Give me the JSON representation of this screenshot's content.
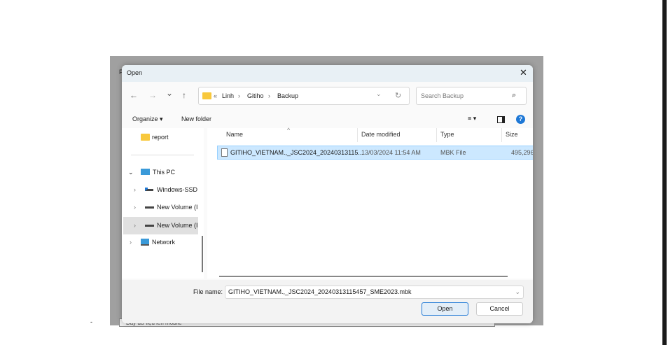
{
  "background": {
    "left_char": "P",
    "dash": "-",
    "bottom_text": "Đẩy dữ liệu lên mobile"
  },
  "dialog": {
    "title": "Open",
    "close": "✕"
  },
  "nav": {
    "back": "←",
    "forward": "→",
    "recent": "⌄",
    "up": "↑"
  },
  "address": {
    "overflow": "«",
    "crumbs": [
      "Linh",
      "Gitiho",
      "Backup"
    ],
    "sep": "›",
    "dropdown": "⌄",
    "refresh": "↻"
  },
  "search": {
    "placeholder": "Search Backup",
    "icon": "⌕"
  },
  "toolbar": {
    "organize": "Organize ▾",
    "new_folder": "New folder",
    "view": "≡ ▾",
    "help": "?"
  },
  "sidebar": {
    "items": [
      {
        "label": "report",
        "icon": "folder-icon"
      },
      {
        "label": "This PC",
        "chevron": "⌄",
        "icon": "computer-icon"
      },
      {
        "label": "Windows-SSD",
        "chevron": "›",
        "icon": "drive-icon"
      },
      {
        "label": "New Volume (I",
        "chevron": "›",
        "icon": "drive-icon"
      },
      {
        "label": "New Volume (I",
        "chevron": "›",
        "icon": "drive-icon",
        "selected": true
      },
      {
        "label": "Network",
        "chevron": "›",
        "icon": "network-icon"
      }
    ]
  },
  "columns": {
    "name": "Name",
    "date": "Date modified",
    "type": "Type",
    "size": "Size",
    "sort": "^"
  },
  "files": [
    {
      "name": "GITIHO_VIETNAM.,_JSC2024_20240313115...",
      "date": "13/03/2024 11:54 AM",
      "type": "MBK File",
      "size": "495,296"
    }
  ],
  "footer": {
    "file_name_label": "File name:",
    "file_name_value": "GITIHO_VIETNAM.,_JSC2024_20240313115457_SME2023.mbk",
    "open": "Open",
    "cancel": "Cancel"
  }
}
